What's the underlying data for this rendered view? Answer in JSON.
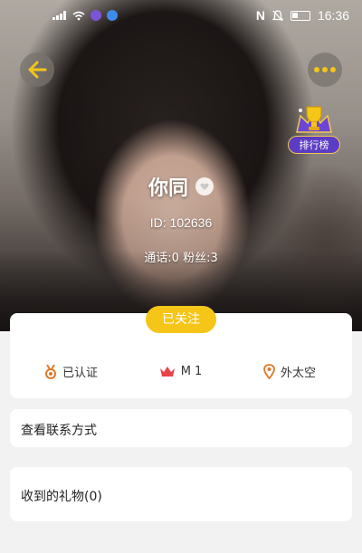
{
  "status_bar": {
    "time": "16:36",
    "battery": "27"
  },
  "profile": {
    "name": "你同",
    "id_text": "ID: 102636",
    "stats_text": "通话:0  粉丝:3",
    "follow_label": "已关注",
    "rank_label": "排行榜"
  },
  "tags": [
    {
      "icon": "medal-icon",
      "label": "已认证",
      "color": "#e0792a"
    },
    {
      "icon": "crown-icon",
      "label": "M 1",
      "color": "#e8424a"
    },
    {
      "icon": "location-pin-icon",
      "label": "外太空",
      "color": "#e0792a"
    }
  ],
  "rows": {
    "contact": "查看联系方式",
    "gifts": "收到的礼物(0)"
  },
  "colors": {
    "accent": "#f5c518",
    "rank_purple": "#5b3cc4",
    "background": "#f2f2f2"
  }
}
